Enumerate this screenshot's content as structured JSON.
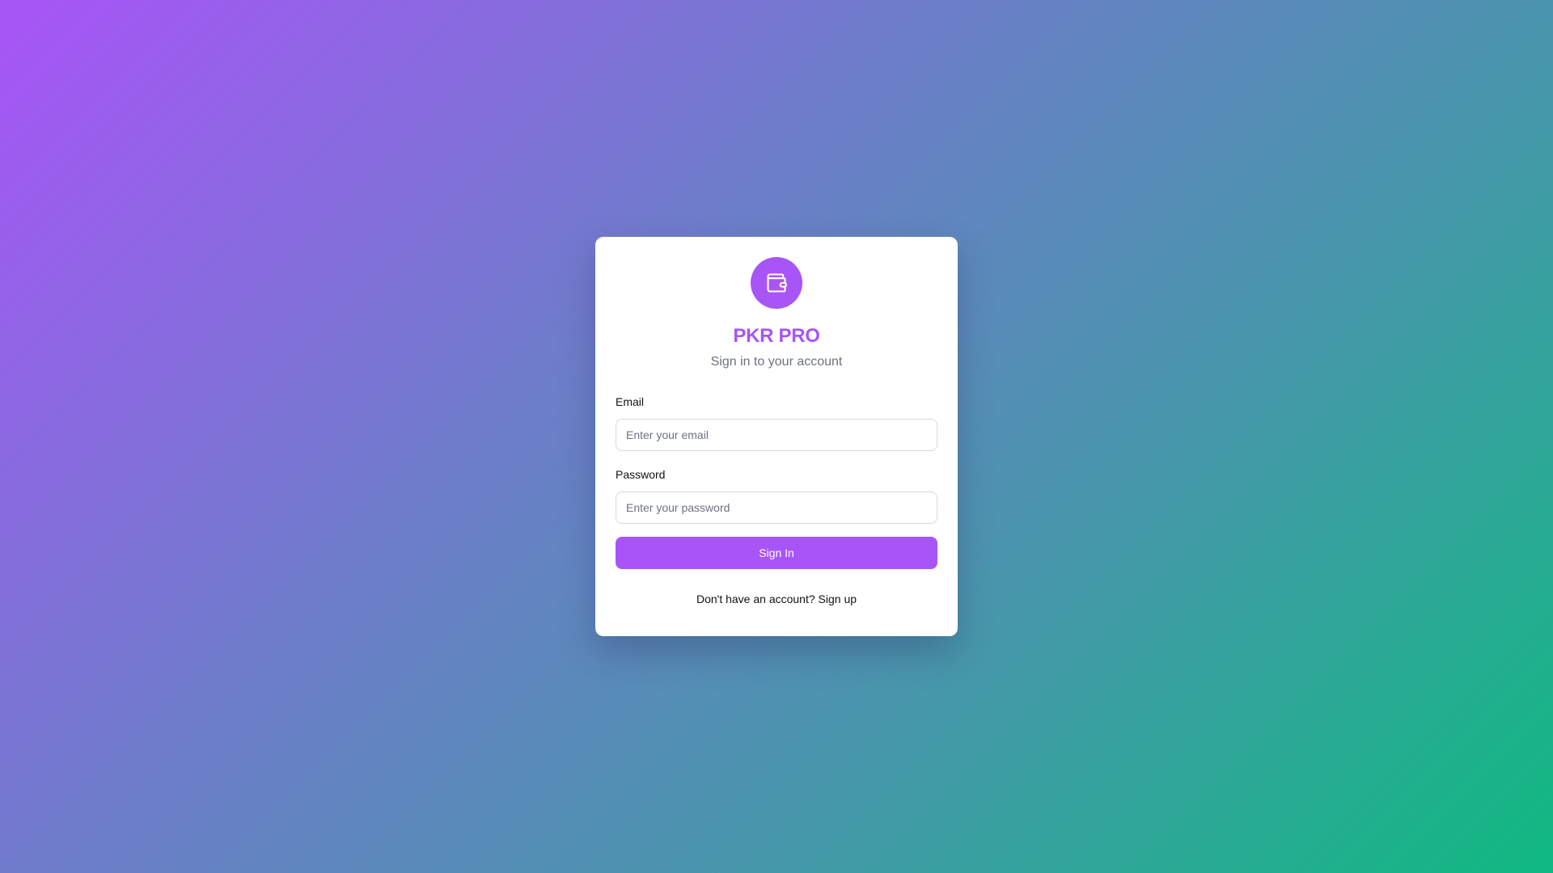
{
  "brand": {
    "title": "PKR PRO",
    "subtitle": "Sign in to your account",
    "logo_icon": "wallet-icon",
    "accent_color": "#a855f7"
  },
  "form": {
    "email": {
      "label": "Email",
      "placeholder": "Enter your email",
      "value": ""
    },
    "password": {
      "label": "Password",
      "placeholder": "Enter your password",
      "value": ""
    },
    "submit_label": "Sign In"
  },
  "footer": {
    "prompt": "Don't have an account?",
    "link_label": "Sign up"
  },
  "colors": {
    "gradient_start": "#a855f7",
    "gradient_end": "#10b981",
    "muted_text": "#6b7280"
  }
}
